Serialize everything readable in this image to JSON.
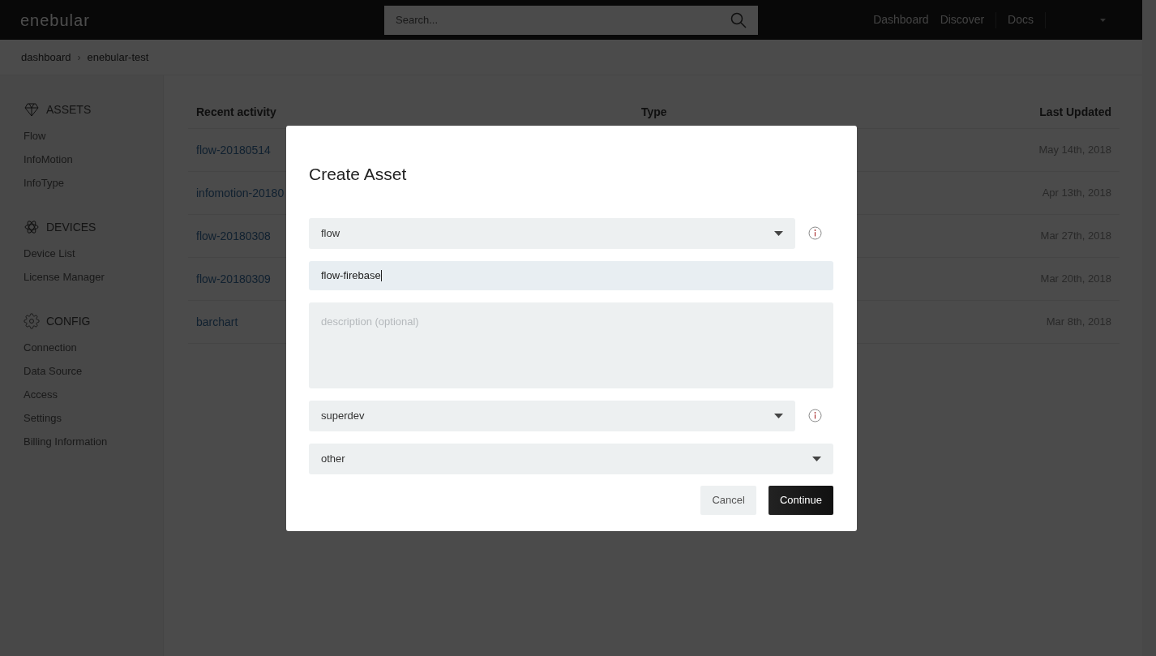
{
  "header": {
    "logo": "enebular",
    "search": {
      "placeholder": "Search..."
    },
    "nav": [
      {
        "label": "Dashboard"
      },
      {
        "label": "Discover"
      },
      {
        "label": "Docs"
      }
    ]
  },
  "breadcrumb": {
    "separator": "›",
    "items": [
      "dashboard",
      "enebular-test"
    ]
  },
  "sidebar": [
    {
      "title": "ASSETS",
      "items": [
        "Flow",
        "InfoMotion",
        "InfoType"
      ]
    },
    {
      "title": "DEVICES",
      "items": [
        "Device List",
        "License Manager"
      ]
    },
    {
      "title": "CONFIG",
      "items": [
        "Connection",
        "Data Source",
        "Access",
        "Settings",
        "Billing Information"
      ]
    }
  ],
  "table": {
    "columns": [
      "Recent activity",
      "Type",
      "Last Updated"
    ],
    "rows": [
      {
        "name": "flow-20180514",
        "updated": "May 14th, 2018"
      },
      {
        "name": "infomotion-20180",
        "updated": "Apr 13th, 2018"
      },
      {
        "name": "flow-20180308",
        "updated": "Mar 27th, 2018"
      },
      {
        "name": "flow-20180309",
        "updated": "Mar 20th, 2018"
      },
      {
        "name": "barchart",
        "updated": "Mar 8th, 2018"
      }
    ]
  },
  "dialog": {
    "title": "Create Asset",
    "fields": [
      {
        "kind": "select",
        "value": "flow",
        "info": true
      },
      {
        "kind": "text",
        "value": "flow-firebase"
      },
      {
        "kind": "textarea",
        "placeholder": "description (optional)"
      },
      {
        "kind": "select",
        "value": "superdev",
        "info": true
      },
      {
        "kind": "select",
        "value": "other",
        "info": false
      }
    ],
    "buttons": [
      {
        "label": "Cancel",
        "primary": false
      },
      {
        "label": "Continue",
        "primary": true
      }
    ]
  }
}
